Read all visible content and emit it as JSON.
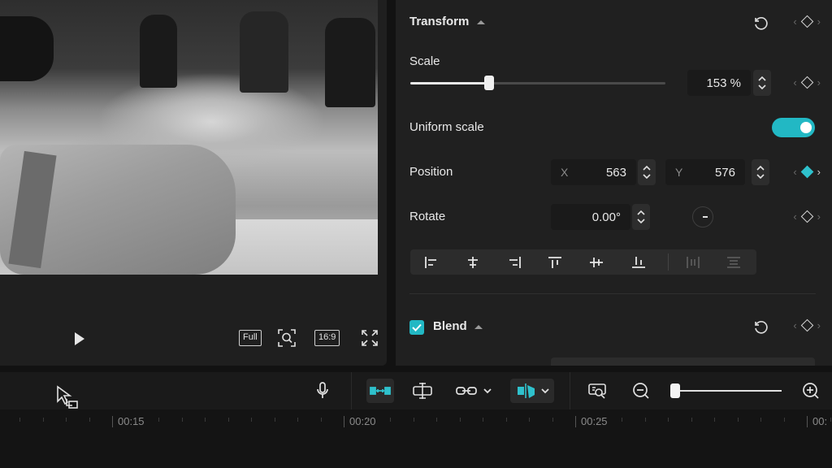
{
  "preview": {
    "controls": {
      "full_label": "Full",
      "ratio_label": "16:9"
    }
  },
  "transform": {
    "title": "Transform",
    "scale": {
      "label": "Scale",
      "value": "153 %",
      "level": 0.31
    },
    "uniform_scale": {
      "label": "Uniform scale",
      "enabled": true
    },
    "position": {
      "label": "Position",
      "x_axis": "X",
      "x_value": "563",
      "y_axis": "Y",
      "y_value": "576"
    },
    "rotate": {
      "label": "Rotate",
      "value": "0.00°"
    }
  },
  "blend": {
    "title": "Blend",
    "checked": true
  },
  "timeline": {
    "ruler_labels": [
      "00:15",
      "00:20",
      "00:25",
      "00:"
    ]
  },
  "colors": {
    "accent": "#22b8c4",
    "panel": "#202020",
    "background": "#121212"
  }
}
